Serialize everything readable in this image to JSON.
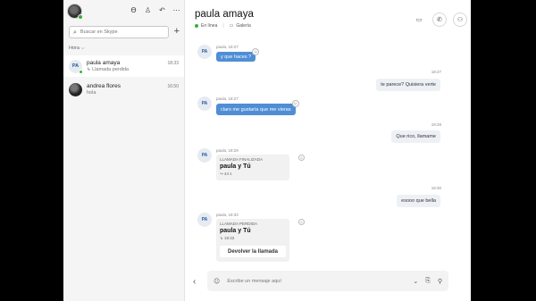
{
  "sidebar": {
    "top_icons": [
      "ϴ",
      "♙",
      "↶",
      "⋯"
    ],
    "search_placeholder": "Buscar en Skype",
    "new_chat": "+",
    "section_label": "Hora ⌵",
    "chats": [
      {
        "initials": "PA",
        "name": "paula amaya",
        "sub": "↳ Llamada perdida",
        "time": "18:33"
      },
      {
        "name": "andrea flores",
        "sub": "hola",
        "time": "16:50"
      }
    ]
  },
  "header": {
    "name": "paula amaya",
    "status": "En línea",
    "gallery": "Galería",
    "gallery_icon": "▭",
    "btn_video": "▭",
    "btn_call": "✆",
    "btn_add": "⚇"
  },
  "messages": {
    "m1": {
      "initials": "PA",
      "meta": "paula, 18:27",
      "text": "y que haces ?"
    },
    "m2": {
      "time": "18:27",
      "text": "te parece? Quisiera verte"
    },
    "m3": {
      "initials": "PA",
      "meta": "paula, 18:27",
      "text": "claro  me gustaría que me vieras"
    },
    "m4": {
      "time": "18:28",
      "text": "Que rico, llamame"
    },
    "m5": {
      "initials": "PA",
      "meta": "paula, 18:29",
      "label": "LLAMADA FINALIZADA",
      "who": "paula y Tú",
      "duration": "↪ 44 s"
    },
    "m6": {
      "time": "18:30",
      "text": "esooo que bella"
    },
    "m7": {
      "initials": "PA",
      "meta": "paula, 18:33",
      "label": "LLAMADA PERDIDA",
      "who": "paula y Tú",
      "duration": "↳ 18:33",
      "button": "Devolver la llamada"
    }
  },
  "composer": {
    "placeholder": "Escribe un mensaje aquí",
    "back": "‹",
    "emoji": "☺",
    "icons": [
      "⌄",
      "⎘",
      "⚲"
    ]
  },
  "react": "☺"
}
